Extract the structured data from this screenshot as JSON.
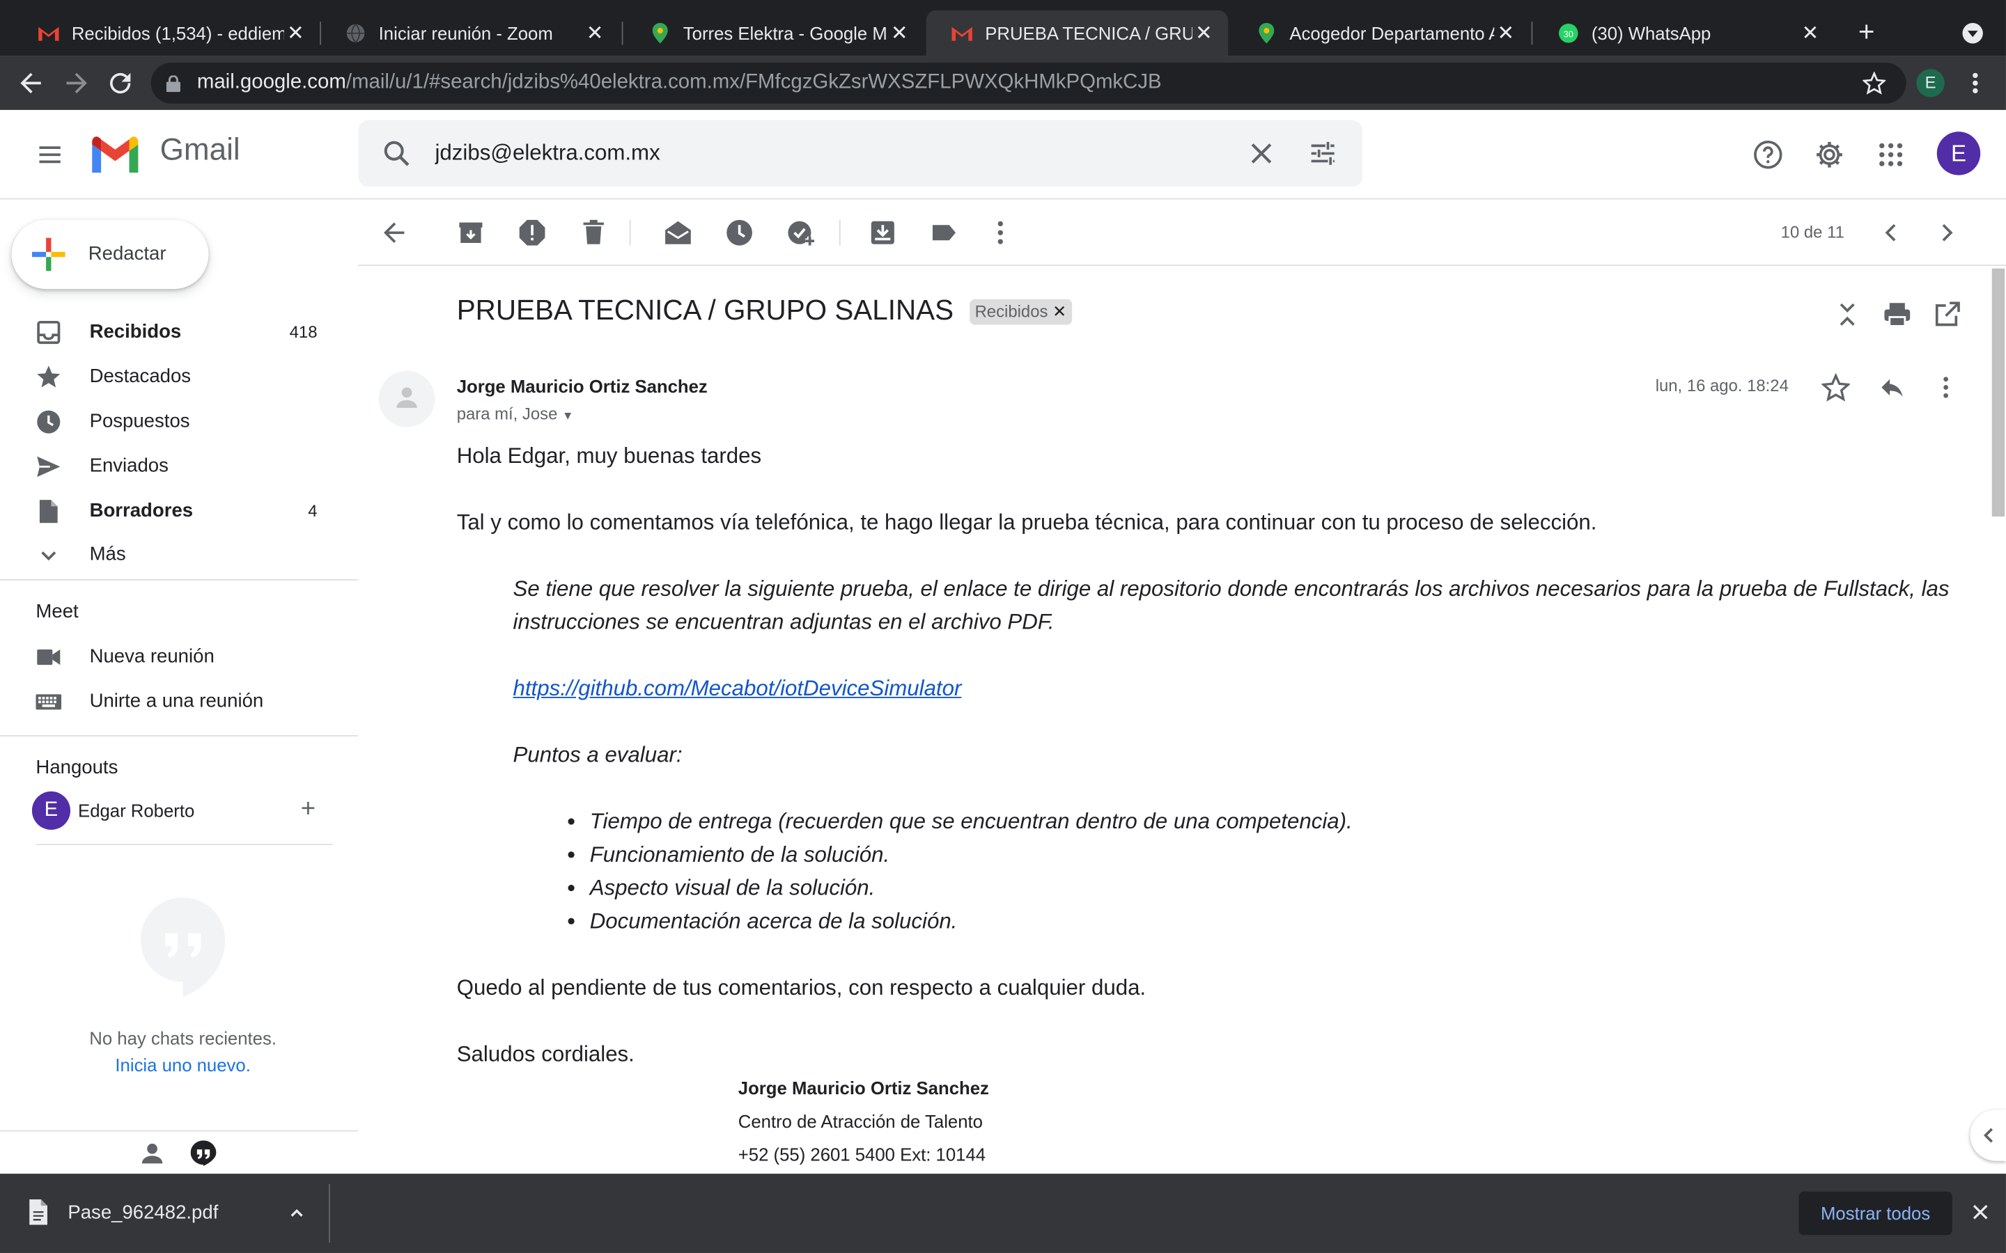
{
  "browser": {
    "tabs": [
      {
        "title": "Recibidos (1,534) - eddiem",
        "icon": "gmail-icon"
      },
      {
        "title": "Iniciar reunión - Zoom",
        "icon": "globe-icon"
      },
      {
        "title": "Torres Elektra - Google Map",
        "icon": "maps-pin-icon"
      },
      {
        "title": "PRUEBA TECNICA / GRUPO",
        "icon": "gmail-icon",
        "active": true
      },
      {
        "title": "Acogedor Departamento Al",
        "icon": "maps-pin-icon"
      },
      {
        "title": "(30) WhatsApp",
        "icon": "whatsapp-icon"
      }
    ],
    "url_host": "mail.google.com",
    "url_path": "/mail/u/1/#search/jdzibs%40elektra.com.mx/FMfcgzGkZsrWXSZFLPWXQkHMkPQmkCJB",
    "profile_initial": "E"
  },
  "header": {
    "app_name": "Gmail",
    "search_value": "jdzibs@elektra.com.mx",
    "avatar_initial": "E"
  },
  "sidebar": {
    "compose_label": "Redactar",
    "items": [
      {
        "label": "Recibidos",
        "count": "418",
        "bold": true,
        "icon": "inbox-icon"
      },
      {
        "label": "Destacados",
        "count": "",
        "icon": "star-icon"
      },
      {
        "label": "Pospuestos",
        "count": "",
        "icon": "clock-icon"
      },
      {
        "label": "Enviados",
        "count": "",
        "icon": "send-icon"
      },
      {
        "label": "Borradores",
        "count": "4",
        "bold": true,
        "icon": "draft-icon"
      },
      {
        "label": "Más",
        "count": "",
        "icon": "chevron-down-icon"
      }
    ],
    "meet_title": "Meet",
    "meet_items": [
      {
        "label": "Nueva reunión",
        "icon": "video-icon"
      },
      {
        "label": "Unirte a una reunión",
        "icon": "keyboard-icon"
      }
    ],
    "hangouts_title": "Hangouts",
    "hangouts_user": "Edgar Roberto",
    "hangouts_user_initial": "E",
    "no_chats": "No hay chats recientes.",
    "new_chat": "Inicia uno nuevo."
  },
  "toolbar": {
    "pager": "10 de 11"
  },
  "email": {
    "subject": "PRUEBA TECNICA / GRUPO SALINAS",
    "label": "Recibidos",
    "sender": "Jorge Mauricio Ortiz Sanchez",
    "to": "para mí, Jose",
    "date": "lun, 16 ago. 18:24",
    "greeting": "Hola Edgar, muy buenas tardes",
    "intro": "Tal y como lo comentamos vía telefónica, te hago llegar la prueba técnica, para continuar con tu proceso de selección.",
    "quote_text": "Se tiene que resolver la siguiente prueba, el enlace te dirige al repositorio donde encontrarás los archivos necesarios para la prueba de Fullstack, las instrucciones se encuentran adjuntas en el archivo PDF.",
    "link": "https://github.com/Mecabot/iotDeviceSimulator",
    "eval_title": "Puntos a evaluar:",
    "eval_points": [
      "Tiempo de entrega (recuerden que se encuentran dentro de una competencia).",
      "Funcionamiento de la solución.",
      "Aspecto visual de la solución.",
      "Documentación acerca de la solución."
    ],
    "closing": "Quedo al pendiente de tus comentarios, con respecto a cualquier duda.",
    "regards": "Saludos cordiales.",
    "sig_name": "Jorge Mauricio Ortiz Sanchez",
    "sig_dept": "Centro de Atracción de Talento",
    "sig_phone": "+52 (55) 2601 5400 Ext: 10144"
  },
  "download": {
    "filename": "Pase_962482.pdf",
    "show_all": "Mostrar todos"
  },
  "colors": {
    "accent_blue": "#1a73e8",
    "avatar_purple": "#512da8",
    "link": "#1155cc"
  }
}
